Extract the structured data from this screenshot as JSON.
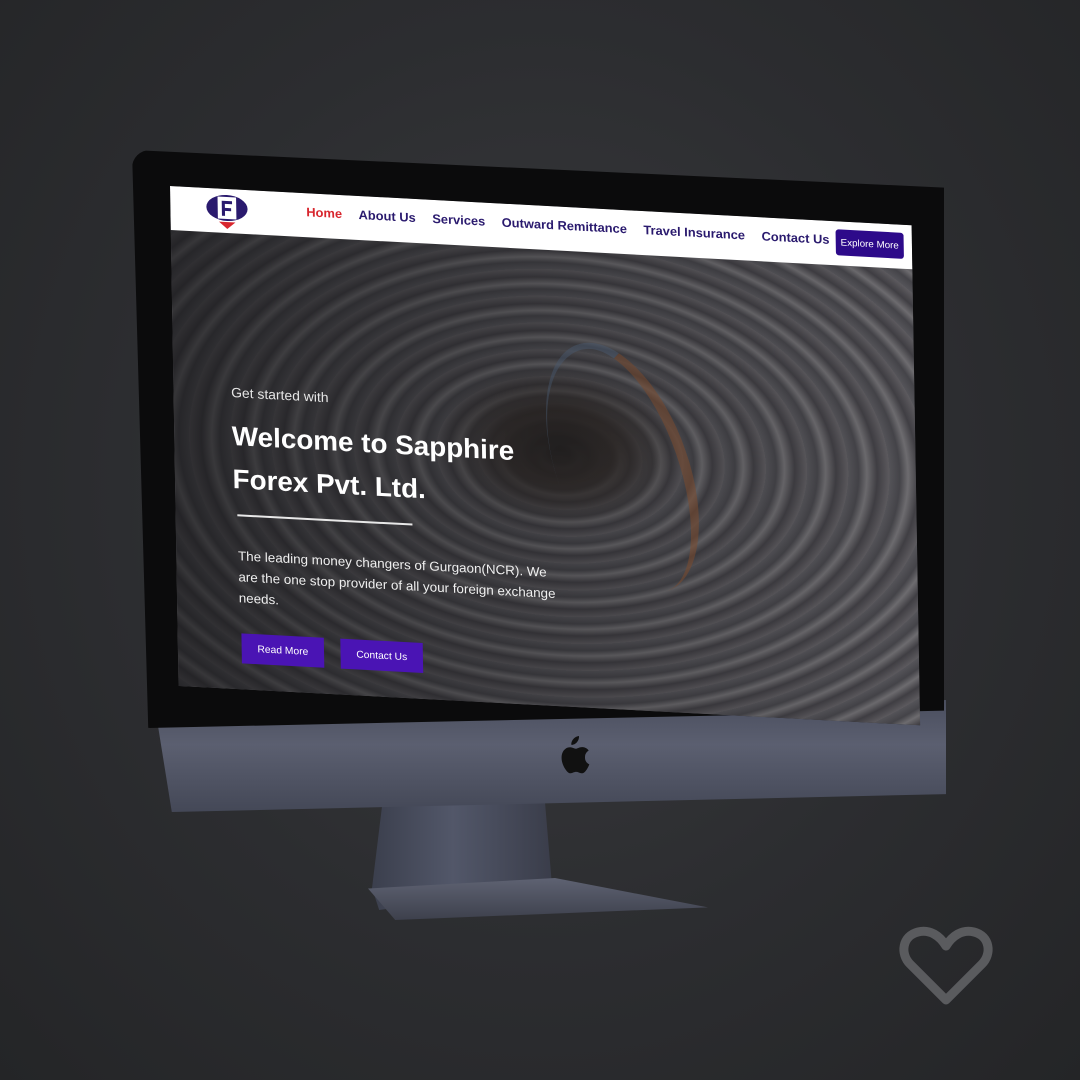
{
  "site": {
    "nav": {
      "items": [
        {
          "label": "Home",
          "active": true
        },
        {
          "label": "About Us",
          "active": false
        },
        {
          "label": "Services",
          "active": false
        },
        {
          "label": "Outward Remittance",
          "active": false
        },
        {
          "label": "Travel Insurance",
          "active": false
        },
        {
          "label": "Contact Us",
          "active": false
        }
      ],
      "cta_label": "Explore More"
    },
    "hero": {
      "kicker": "Get started with",
      "title": "Welcome to Sapphire Forex Pvt. Ltd.",
      "description": "The leading money changers of Gurgaon(NCR). We are the one stop provider of all your foreign exchange needs.",
      "buttons": {
        "read_more": "Read More",
        "contact_us": "Contact Us"
      }
    }
  },
  "colors": {
    "background": "#2c2d30",
    "nav_text": "#2a1a6e",
    "nav_active": "#d8262e",
    "primary_button": "#4a14b4",
    "cta_button": "#2d0a8a"
  },
  "icons": {
    "device_logo": "apple-icon",
    "overlay": "heart-icon",
    "site_logo": "sapphire-forex-logo"
  }
}
